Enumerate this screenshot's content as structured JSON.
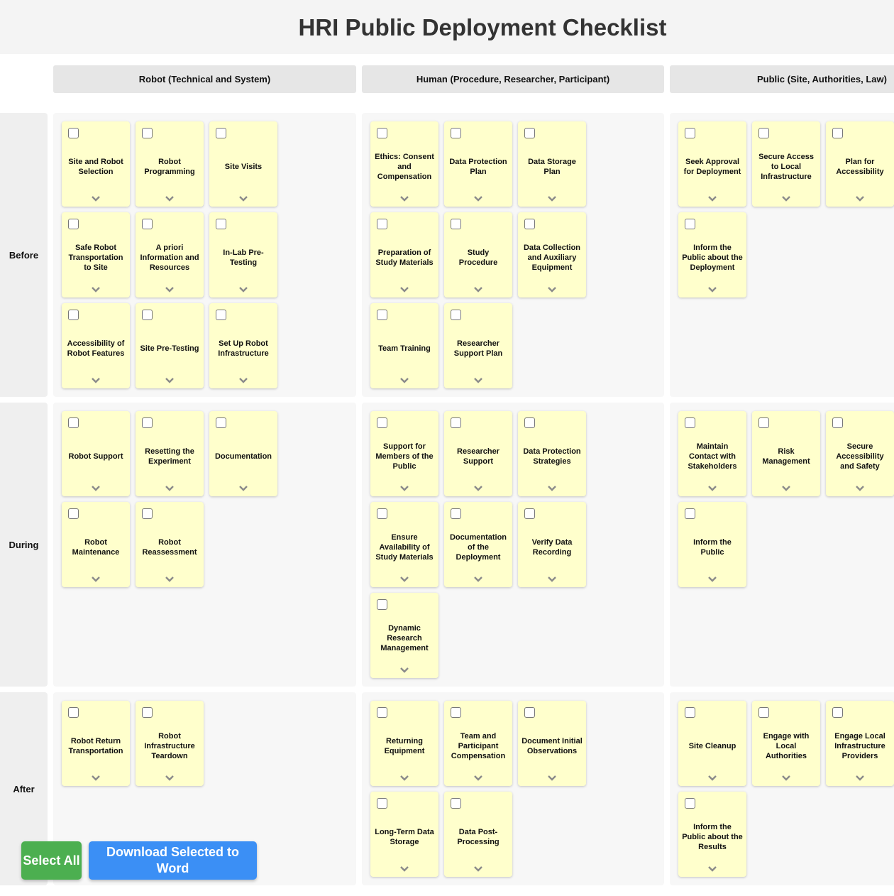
{
  "title": "HRI Public Deployment Checklist",
  "columns": [
    "Robot (Technical and System)",
    "Human (Procedure, Researcher, Participant)",
    "Public (Site, Authorities, Law)"
  ],
  "rows": [
    "Before",
    "During",
    "After"
  ],
  "cells": [
    [
      [
        "Site and Robot Selection",
        "Robot Programming",
        "Site Visits",
        "Safe Robot Transportation to Site",
        "A priori Information and Resources",
        "In-Lab Pre-Testing",
        "Accessibility of Robot Features",
        "Site Pre-Testing",
        "Set Up Robot Infrastructure"
      ],
      [
        "Ethics: Consent and Compensation",
        "Data Protection Plan",
        "Data Storage Plan",
        "Preparation of Study Materials",
        "Study Procedure",
        "Data Collection and Auxiliary Equipment",
        "Team Training",
        "Researcher Support Plan"
      ],
      [
        "Seek Approval for Deployment",
        "Secure Access to Local Infrastructure",
        "Plan for Accessibility",
        "Inform the Public about the Deployment"
      ]
    ],
    [
      [
        "Robot Support",
        "Resetting the Experiment",
        "Documentation",
        "Robot Maintenance",
        "Robot Reassessment"
      ],
      [
        "Support for Members of the Public",
        "Researcher Support",
        "Data Protection Strategies",
        "Ensure Availability of Study Materials",
        "Documentation of the Deployment",
        "Verify Data Recording",
        "Dynamic Research Management"
      ],
      [
        "Maintain Contact with Stakeholders",
        "Risk Management",
        "Secure Accessibility and Safety",
        "Inform the Public"
      ]
    ],
    [
      [
        "Robot Return Transportation",
        "Robot Infrastructure Teardown"
      ],
      [
        "Returning Equipment",
        "Team and Participant Compensation",
        "Document Initial Observations",
        "Long-Term Data Storage",
        "Data Post-Processing"
      ],
      [
        "Site Cleanup",
        "Engage with Local Authorities",
        "Engage Local Infrastructure Providers",
        "Inform the Public about the Results"
      ]
    ]
  ],
  "buttons": {
    "select_all": "Select All",
    "download": "Download Selected to Word"
  },
  "colors": {
    "card": "#ffffcc",
    "select_button": "#4caf50",
    "download_button": "#3b8ff5"
  }
}
